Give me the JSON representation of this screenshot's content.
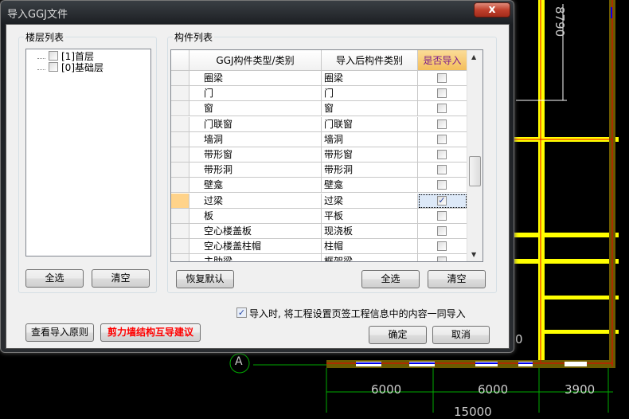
{
  "dialog": {
    "title": "导入GGJ文件",
    "close_label": "x"
  },
  "floors": {
    "label": "楼层列表",
    "items": [
      "[1]首层",
      "[0]基础层"
    ],
    "select_all": "全选",
    "clear": "清空"
  },
  "components": {
    "label": "构件列表",
    "headers": [
      "GGJ构件类型/类别",
      "导入后构件类别",
      "是否导入"
    ],
    "rows": [
      {
        "src": "圈梁",
        "dst": "圈梁",
        "checked": false
      },
      {
        "src": "门",
        "dst": "门",
        "checked": false
      },
      {
        "src": "窗",
        "dst": "窗",
        "checked": false
      },
      {
        "src": "门联窗",
        "dst": "门联窗",
        "checked": false
      },
      {
        "src": "墙洞",
        "dst": "墙洞",
        "checked": false
      },
      {
        "src": "带形窗",
        "dst": "带形窗",
        "checked": false
      },
      {
        "src": "带形洞",
        "dst": "带形洞",
        "checked": false
      },
      {
        "src": "壁龛",
        "dst": "壁龛",
        "checked": false
      },
      {
        "src": "过梁",
        "dst": "过梁",
        "checked": true,
        "selected": true
      },
      {
        "src": "板",
        "dst": "平板",
        "checked": false
      },
      {
        "src": "空心楼盖板",
        "dst": "现浇板",
        "checked": false
      },
      {
        "src": "空心楼盖柱帽",
        "dst": "柱帽",
        "checked": false
      },
      {
        "src": "主肋梁",
        "dst": "框架梁",
        "checked": false
      }
    ],
    "restore_default": "恢复默认",
    "select_all": "全选",
    "clear": "清空"
  },
  "import_info": {
    "label": "导入时, 将工程设置页签工程信息中的内容一同导入",
    "checked": true
  },
  "footer": {
    "view_rules": "查看导入原则",
    "shear_wall_advice": "剪力墙结构互导建议",
    "ok": "确定",
    "cancel": "取消"
  },
  "cad": {
    "dim_vertical": "8790",
    "dims": [
      "6000",
      "6000",
      "3900"
    ],
    "total": "15000",
    "axis": "A",
    "partial_digit": "0"
  },
  "colors": {
    "accent_header": "#f7c86a",
    "warning_text": "#ff0000",
    "selected_row_header": "#ffd38a"
  }
}
